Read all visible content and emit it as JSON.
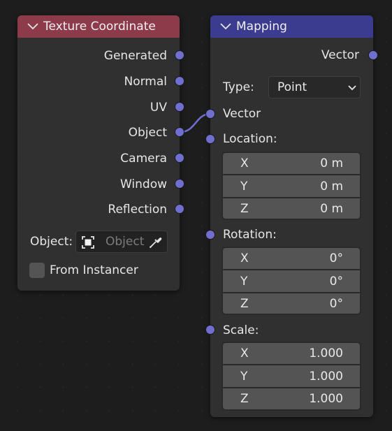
{
  "texture_coordinate": {
    "title": "Texture Coordinate",
    "header_color": "#8d3a4a",
    "outputs": [
      "Generated",
      "Normal",
      "UV",
      "Object",
      "Camera",
      "Window",
      "Reflection"
    ],
    "object_label": "Object:",
    "object_placeholder": "Object",
    "from_instancer_label": "From Instancer",
    "from_instancer_checked": false
  },
  "mapping": {
    "title": "Mapping",
    "header_color": "#3b3b8f",
    "output_label": "Vector",
    "type_label": "Type:",
    "type_value": "Point",
    "input_vector_label": "Vector",
    "location": {
      "label": "Location:",
      "rows": [
        {
          "axis": "X",
          "value": "0 m"
        },
        {
          "axis": "Y",
          "value": "0 m"
        },
        {
          "axis": "Z",
          "value": "0 m"
        }
      ]
    },
    "rotation": {
      "label": "Rotation:",
      "rows": [
        {
          "axis": "X",
          "value": "0°"
        },
        {
          "axis": "Y",
          "value": "0°"
        },
        {
          "axis": "Z",
          "value": "0°"
        }
      ]
    },
    "scale": {
      "label": "Scale:",
      "rows": [
        {
          "axis": "X",
          "value": "1.000"
        },
        {
          "axis": "Y",
          "value": "1.000"
        },
        {
          "axis": "Z",
          "value": "1.000"
        }
      ]
    }
  },
  "colors": {
    "socket_vector": "#6f6fd0",
    "link": "#6f6fd0",
    "node_body": "#303030",
    "canvas": "#1d1d1d"
  }
}
